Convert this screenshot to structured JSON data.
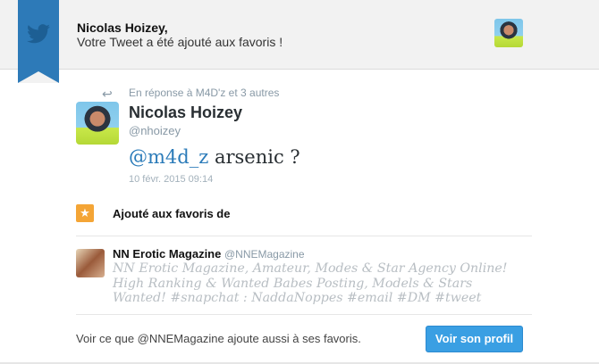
{
  "header": {
    "name": "Nicolas Hoizey,",
    "message": "Votre Tweet a été ajouté aux favoris !"
  },
  "tweet": {
    "reply_to": "En réponse à M4D'z et 3 autres",
    "name": "Nicolas Hoizey",
    "handle": "@nhoizey",
    "mention": "@m4d_z",
    "text": " arsenic ?",
    "date": "10 févr. 2015 09:14"
  },
  "favorites": {
    "label": "Ajouté aux favoris de"
  },
  "user": {
    "name": "NN Erotic Magazine",
    "handle": "@NNEMagazine",
    "bio": "NN Erotic Magazine, Amateur, Modes & Star Agency Online! High Ranking & Wanted Babes Posting, Models & Stars Wanted! #snapchat : NaddaNoppes #email #DM #tweet"
  },
  "footer": {
    "text": "Voir ce que @NNEMagazine ajoute aussi à ses favoris.",
    "button": "Voir son profil"
  },
  "colors": {
    "accent": "#2b7bb9",
    "star": "#f4a536",
    "button": "#3a9fe3"
  }
}
